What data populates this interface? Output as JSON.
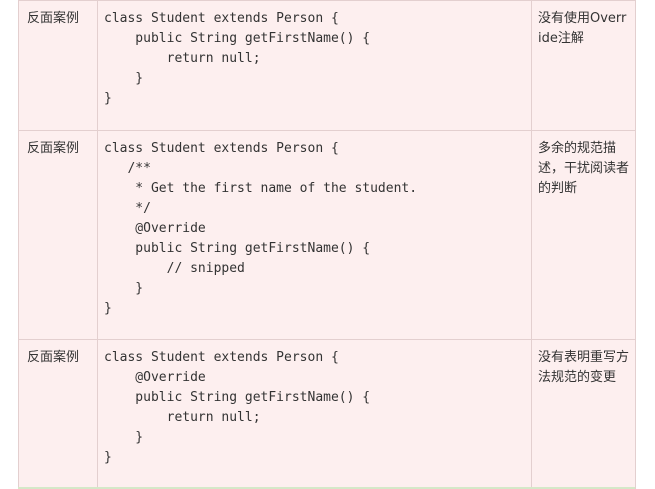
{
  "rows": [
    {
      "label": "反面案例",
      "code": "class Student extends Person {\n    public String getFirstName() {\n        return null;\n    }\n}",
      "note": "没有使用Override注解"
    },
    {
      "label": "反面案例",
      "code": "class Student extends Person {\n   /**\n    * Get the first name of the student.\n    */\n    @Override\n    public String getFirstName() {\n        // snipped\n    }\n}",
      "note": "多余的规范描述，干扰阅读者的判断"
    },
    {
      "label": "反面案例",
      "code": "class Student extends Person {\n    @Override\n    public String getFirstName() {\n        return null;\n    }\n}",
      "note": "没有表明重写方法规范的变更"
    }
  ]
}
